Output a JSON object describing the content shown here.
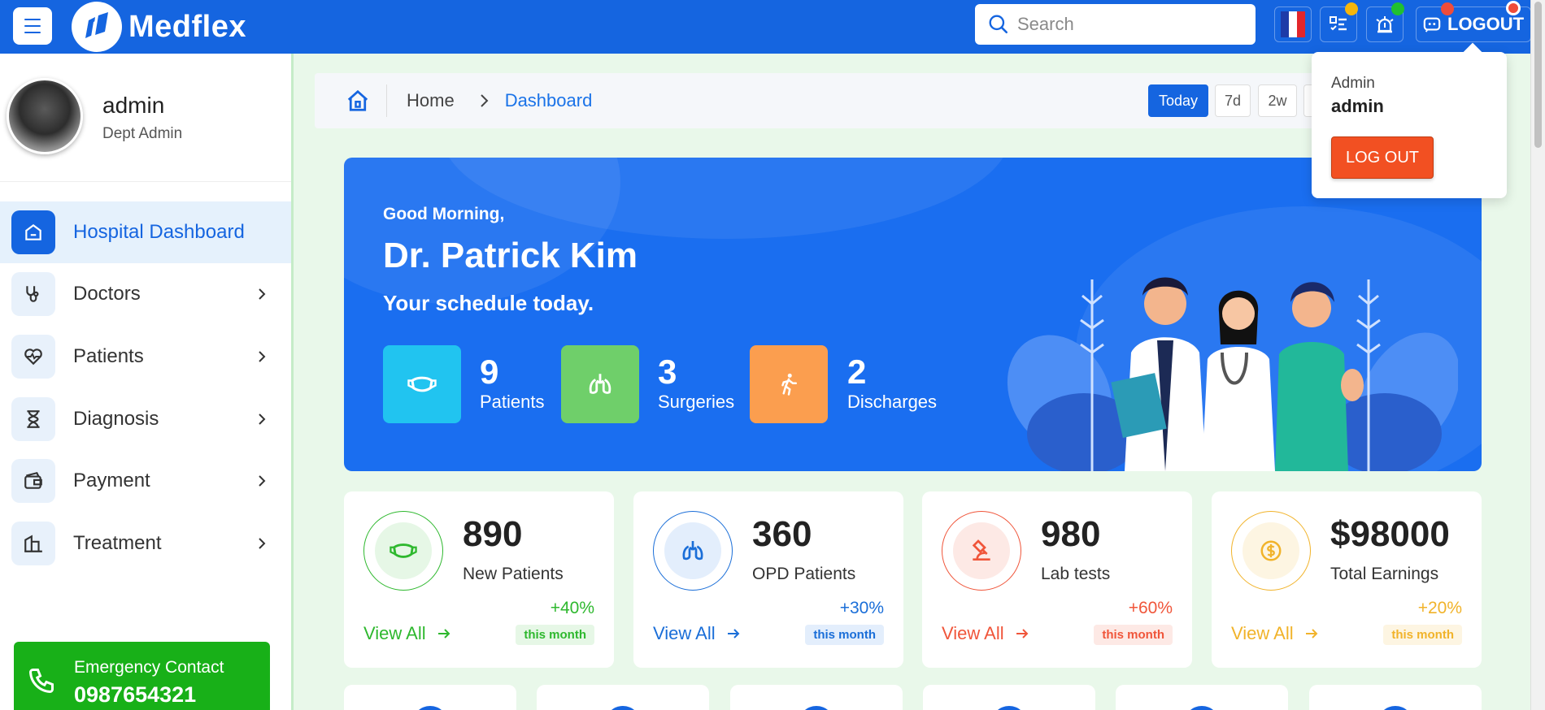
{
  "app": {
    "name": "Medflex"
  },
  "header": {
    "search_placeholder": "Search",
    "logout_label": "LOGOUT",
    "colors": {
      "bar": "#1565e0",
      "dot_yellow": "#f5b60d",
      "dot_green": "#20c030",
      "dot_red": "#f04c3a"
    }
  },
  "profile": {
    "name": "admin",
    "role": "Dept Admin"
  },
  "sidebar": {
    "items": [
      {
        "label": "Hospital Dashboard",
        "icon": "home-icon",
        "active": true
      },
      {
        "label": "Doctors",
        "icon": "stethoscope-icon"
      },
      {
        "label": "Patients",
        "icon": "heart-pulse-icon"
      },
      {
        "label": "Diagnosis",
        "icon": "hourglass-icon"
      },
      {
        "label": "Payment",
        "icon": "wallet-icon"
      },
      {
        "label": "Treatment",
        "icon": "building-icon"
      }
    ],
    "emergency": {
      "label": "Emergency Contact",
      "phone": "0987654321"
    }
  },
  "breadcrumb": {
    "home": "Home",
    "current": "Dashboard"
  },
  "ranges": [
    "Today",
    "7d",
    "2w"
  ],
  "hero": {
    "greeting": "Good Morning,",
    "doctor": "Dr. Patrick Kim",
    "subtitle": "Your schedule today.",
    "stats": [
      {
        "value": "9",
        "label": "Patients",
        "color": "#21c4f0"
      },
      {
        "value": "3",
        "label": "Surgeries",
        "color": "#6fcf6a"
      },
      {
        "value": "2",
        "label": "Discharges",
        "color": "#fb9e4f"
      }
    ]
  },
  "cards": [
    {
      "value": "890",
      "label": "New Patients",
      "pct": "+40%",
      "period": "this month",
      "view": "View All",
      "color": "#2eb82e",
      "tint": "#e6f7e6"
    },
    {
      "value": "360",
      "label": "OPD Patients",
      "pct": "+30%",
      "period": "this month",
      "view": "View All",
      "color": "#1a6ed8",
      "tint": "#e3eefc"
    },
    {
      "value": "980",
      "label": "Lab tests",
      "pct": "+60%",
      "period": "this month",
      "view": "View All",
      "color": "#f0553a",
      "tint": "#fde9e5"
    },
    {
      "value": "$98000",
      "label": "Total Earnings",
      "pct": "+20%",
      "period": "this month",
      "view": "View All",
      "color": "#f1b32a",
      "tint": "#fdf5e2"
    }
  ],
  "dropdown": {
    "role": "Admin",
    "name": "admin",
    "button": "LOG OUT"
  }
}
